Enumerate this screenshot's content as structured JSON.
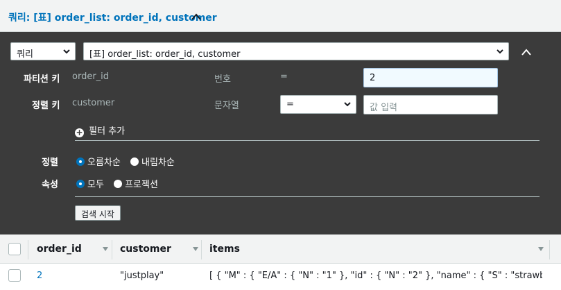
{
  "header": {
    "title": "쿼리: [표] order_list: order_id, customer"
  },
  "query_form": {
    "mode_select": "쿼리",
    "target_select": "[표] order_list: order_id, customer",
    "partition_key": {
      "label": "파티션 키",
      "name": "order_id",
      "type": "번호",
      "operator": "=",
      "value": "2"
    },
    "sort_key": {
      "label": "정렬 키",
      "name": "customer",
      "type": "문자열",
      "operator_select": "=",
      "value_placeholder": "값 입력"
    },
    "add_filter": "필터 추가",
    "sort_order": {
      "label": "정렬",
      "options": [
        "오름차순",
        "내림차순"
      ],
      "selected": "오름차순"
    },
    "attributes": {
      "label": "속성",
      "options": [
        "모두",
        "프로젝션"
      ],
      "selected": "모두"
    },
    "start_search_button": "검색 시작"
  },
  "results_table": {
    "columns": [
      "order_id",
      "customer",
      "items"
    ],
    "rows": [
      {
        "order_id": "2",
        "customer": "\"justplay\"",
        "items": "[ { \"M\" : { \"E/A\" : { \"N\" : \"1\" }, \"id\" : { \"N\" : \"2\" }, \"name\" : { \"S\" : \"strawberr…"
      }
    ]
  },
  "colors": {
    "link": "#0073bb",
    "panel_bg": "#3b3b3b",
    "header_bg": "#f2f3f3",
    "active_input_bg": "#f1faff"
  }
}
